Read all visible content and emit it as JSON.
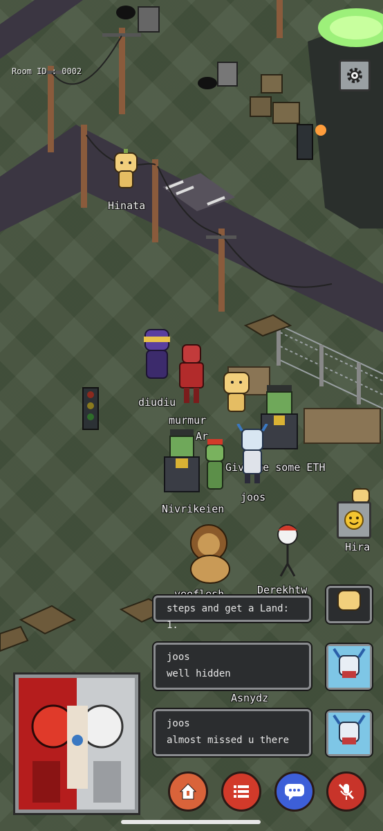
{
  "hud": {
    "room_id": "Room ID : 0002"
  },
  "players": [
    {
      "name": "Hinata"
    },
    {
      "name": "diudiu"
    },
    {
      "name": "murmur"
    },
    {
      "name": "Ar"
    },
    {
      "name": "Give me some ETH"
    },
    {
      "name": "joos"
    },
    {
      "name": "Nivrikeien"
    },
    {
      "name": "Hira"
    },
    {
      "name": "yeeflesh"
    },
    {
      "name": "Derekhtw"
    },
    {
      "name": "Asnydz"
    }
  ],
  "chat": {
    "messages": [
      {
        "sender": "",
        "text": "steps and get a Land: 1."
      },
      {
        "sender": "joos",
        "text": "well hidden"
      },
      {
        "sender": "joos",
        "text": "almost missed u there"
      }
    ]
  },
  "colors": {
    "ground": "#47553f",
    "road": "#3b3642",
    "home_button": "#d9633a",
    "list_button": "#d23a2a",
    "chat_button": "#3d5fd8",
    "mute_button": "#c8342a"
  },
  "icons": {
    "settings": "gear-icon",
    "emote": "smiley-icon",
    "home": "home-icon",
    "list": "list-icon",
    "chat": "chat-bubble-icon",
    "mute": "mic-muted-icon"
  }
}
